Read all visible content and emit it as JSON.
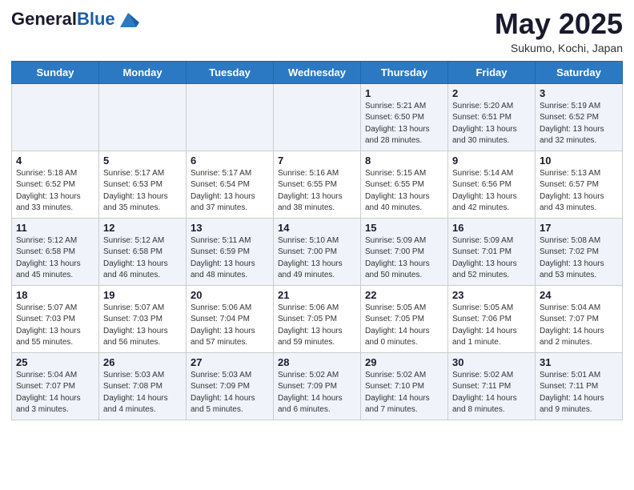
{
  "header": {
    "logo_general": "General",
    "logo_blue": "Blue",
    "title": "May 2025",
    "subtitle": "Sukumo, Kochi, Japan"
  },
  "weekdays": [
    "Sunday",
    "Monday",
    "Tuesday",
    "Wednesday",
    "Thursday",
    "Friday",
    "Saturday"
  ],
  "weeks": [
    [
      {
        "day": "",
        "info": ""
      },
      {
        "day": "",
        "info": ""
      },
      {
        "day": "",
        "info": ""
      },
      {
        "day": "",
        "info": ""
      },
      {
        "day": "1",
        "info": "Sunrise: 5:21 AM\nSunset: 6:50 PM\nDaylight: 13 hours\nand 28 minutes."
      },
      {
        "day": "2",
        "info": "Sunrise: 5:20 AM\nSunset: 6:51 PM\nDaylight: 13 hours\nand 30 minutes."
      },
      {
        "day": "3",
        "info": "Sunrise: 5:19 AM\nSunset: 6:52 PM\nDaylight: 13 hours\nand 32 minutes."
      }
    ],
    [
      {
        "day": "4",
        "info": "Sunrise: 5:18 AM\nSunset: 6:52 PM\nDaylight: 13 hours\nand 33 minutes."
      },
      {
        "day": "5",
        "info": "Sunrise: 5:17 AM\nSunset: 6:53 PM\nDaylight: 13 hours\nand 35 minutes."
      },
      {
        "day": "6",
        "info": "Sunrise: 5:17 AM\nSunset: 6:54 PM\nDaylight: 13 hours\nand 37 minutes."
      },
      {
        "day": "7",
        "info": "Sunrise: 5:16 AM\nSunset: 6:55 PM\nDaylight: 13 hours\nand 38 minutes."
      },
      {
        "day": "8",
        "info": "Sunrise: 5:15 AM\nSunset: 6:55 PM\nDaylight: 13 hours\nand 40 minutes."
      },
      {
        "day": "9",
        "info": "Sunrise: 5:14 AM\nSunset: 6:56 PM\nDaylight: 13 hours\nand 42 minutes."
      },
      {
        "day": "10",
        "info": "Sunrise: 5:13 AM\nSunset: 6:57 PM\nDaylight: 13 hours\nand 43 minutes."
      }
    ],
    [
      {
        "day": "11",
        "info": "Sunrise: 5:12 AM\nSunset: 6:58 PM\nDaylight: 13 hours\nand 45 minutes."
      },
      {
        "day": "12",
        "info": "Sunrise: 5:12 AM\nSunset: 6:58 PM\nDaylight: 13 hours\nand 46 minutes."
      },
      {
        "day": "13",
        "info": "Sunrise: 5:11 AM\nSunset: 6:59 PM\nDaylight: 13 hours\nand 48 minutes."
      },
      {
        "day": "14",
        "info": "Sunrise: 5:10 AM\nSunset: 7:00 PM\nDaylight: 13 hours\nand 49 minutes."
      },
      {
        "day": "15",
        "info": "Sunrise: 5:09 AM\nSunset: 7:00 PM\nDaylight: 13 hours\nand 50 minutes."
      },
      {
        "day": "16",
        "info": "Sunrise: 5:09 AM\nSunset: 7:01 PM\nDaylight: 13 hours\nand 52 minutes."
      },
      {
        "day": "17",
        "info": "Sunrise: 5:08 AM\nSunset: 7:02 PM\nDaylight: 13 hours\nand 53 minutes."
      }
    ],
    [
      {
        "day": "18",
        "info": "Sunrise: 5:07 AM\nSunset: 7:03 PM\nDaylight: 13 hours\nand 55 minutes."
      },
      {
        "day": "19",
        "info": "Sunrise: 5:07 AM\nSunset: 7:03 PM\nDaylight: 13 hours\nand 56 minutes."
      },
      {
        "day": "20",
        "info": "Sunrise: 5:06 AM\nSunset: 7:04 PM\nDaylight: 13 hours\nand 57 minutes."
      },
      {
        "day": "21",
        "info": "Sunrise: 5:06 AM\nSunset: 7:05 PM\nDaylight: 13 hours\nand 59 minutes."
      },
      {
        "day": "22",
        "info": "Sunrise: 5:05 AM\nSunset: 7:05 PM\nDaylight: 14 hours\nand 0 minutes."
      },
      {
        "day": "23",
        "info": "Sunrise: 5:05 AM\nSunset: 7:06 PM\nDaylight: 14 hours\nand 1 minute."
      },
      {
        "day": "24",
        "info": "Sunrise: 5:04 AM\nSunset: 7:07 PM\nDaylight: 14 hours\nand 2 minutes."
      }
    ],
    [
      {
        "day": "25",
        "info": "Sunrise: 5:04 AM\nSunset: 7:07 PM\nDaylight: 14 hours\nand 3 minutes."
      },
      {
        "day": "26",
        "info": "Sunrise: 5:03 AM\nSunset: 7:08 PM\nDaylight: 14 hours\nand 4 minutes."
      },
      {
        "day": "27",
        "info": "Sunrise: 5:03 AM\nSunset: 7:09 PM\nDaylight: 14 hours\nand 5 minutes."
      },
      {
        "day": "28",
        "info": "Sunrise: 5:02 AM\nSunset: 7:09 PM\nDaylight: 14 hours\nand 6 minutes."
      },
      {
        "day": "29",
        "info": "Sunrise: 5:02 AM\nSunset: 7:10 PM\nDaylight: 14 hours\nand 7 minutes."
      },
      {
        "day": "30",
        "info": "Sunrise: 5:02 AM\nSunset: 7:11 PM\nDaylight: 14 hours\nand 8 minutes."
      },
      {
        "day": "31",
        "info": "Sunrise: 5:01 AM\nSunset: 7:11 PM\nDaylight: 14 hours\nand 9 minutes."
      }
    ]
  ]
}
